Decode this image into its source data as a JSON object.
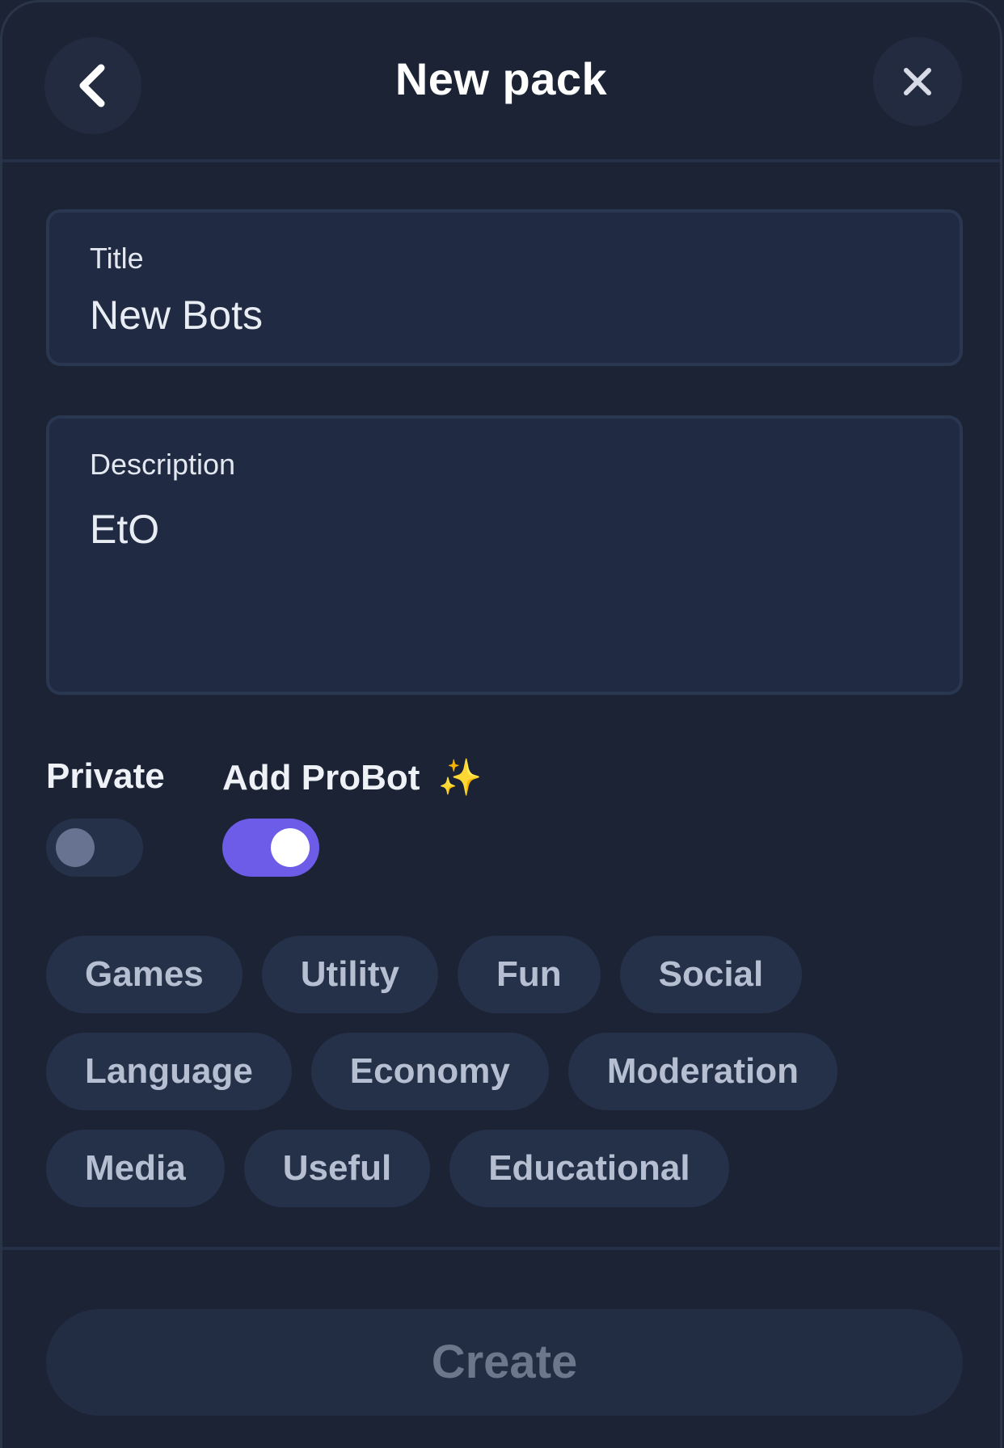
{
  "header": {
    "title": "New pack",
    "back_icon": "chevron-left-icon",
    "close_icon": "close-icon"
  },
  "form": {
    "title_field": {
      "label": "Title",
      "value": "New Bots"
    },
    "description_field": {
      "label": "Description",
      "value": "EtO"
    }
  },
  "toggles": {
    "private": {
      "label": "Private",
      "on": false
    },
    "probot": {
      "label": "Add ProBot",
      "emoji": "✨",
      "on": true
    }
  },
  "tags": {
    "rows": [
      [
        "Games",
        "Utility",
        "Fun",
        "Social"
      ],
      [
        "Language",
        "Economy",
        "Moderation"
      ],
      [
        "Media",
        "Useful",
        "Educational"
      ]
    ]
  },
  "footer": {
    "create_label": "Create"
  },
  "colors": {
    "background": "#1b2335",
    "accent": "#6c5ce7",
    "tag_bg": "#253049",
    "tag_text": "#b6bfd1"
  }
}
